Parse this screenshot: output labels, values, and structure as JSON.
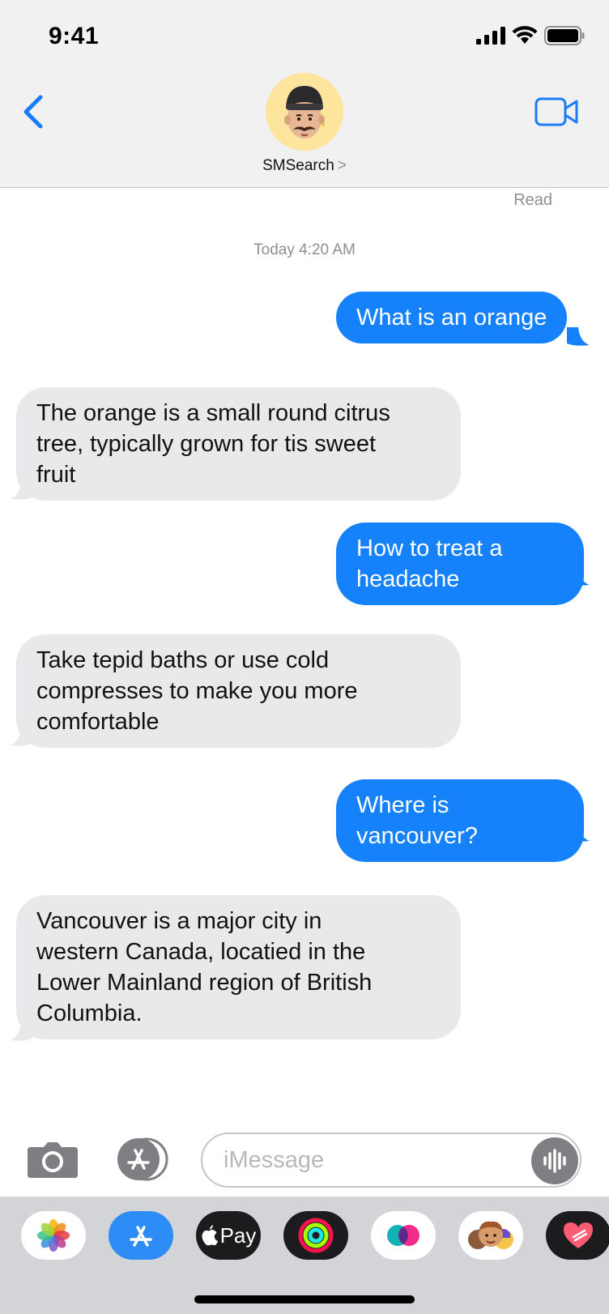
{
  "status_bar": {
    "time": "9:41"
  },
  "header": {
    "contact_name": "SMSearch",
    "chevron": ">"
  },
  "conversation": {
    "read_receipt": "Read",
    "timestamp": "Today 4:20 AM",
    "messages": [
      {
        "direction": "outgoing",
        "lines": [
          "What is an orange"
        ]
      },
      {
        "direction": "incoming",
        "lines": [
          "The orange is a small round citrus",
          "tree, typically grown for tis sweet",
          "fruit"
        ]
      },
      {
        "direction": "outgoing",
        "lines": [
          "How to treat a",
          "headache"
        ]
      },
      {
        "direction": "incoming",
        "lines": [
          "Take tepid baths or use cold",
          "compresses to make you more",
          "comfortable"
        ]
      },
      {
        "direction": "outgoing",
        "lines": [
          "Where is",
          "vancouver?"
        ]
      },
      {
        "direction": "incoming",
        "lines": [
          "Vancouver is a major city in",
          "western Canada, locatied in the",
          "Lower Mainland region of British",
          "Columbia."
        ]
      }
    ]
  },
  "input_bar": {
    "placeholder": "iMessage",
    "value": ""
  },
  "app_drawer": {
    "apps": [
      {
        "name": "photos-app",
        "icon": "photos-icon"
      },
      {
        "name": "app-store-app",
        "icon": "app-store-icon"
      },
      {
        "name": "apple-pay-app",
        "icon": "apple-pay-icon",
        "label": "Pay"
      },
      {
        "name": "activity-app",
        "icon": "activity-rings-icon"
      },
      {
        "name": "digital-touch-app",
        "icon": "digital-touch-icon"
      },
      {
        "name": "memoji-stickers-app",
        "icon": "memoji-icon"
      },
      {
        "name": "music-app",
        "icon": "heart-music-icon"
      }
    ]
  },
  "colors": {
    "outgoing_bubble": "#1581fb",
    "incoming_bubble": "#e9e9eb",
    "accent": "#1a7cf7",
    "header_background": "#f1f1f2"
  }
}
